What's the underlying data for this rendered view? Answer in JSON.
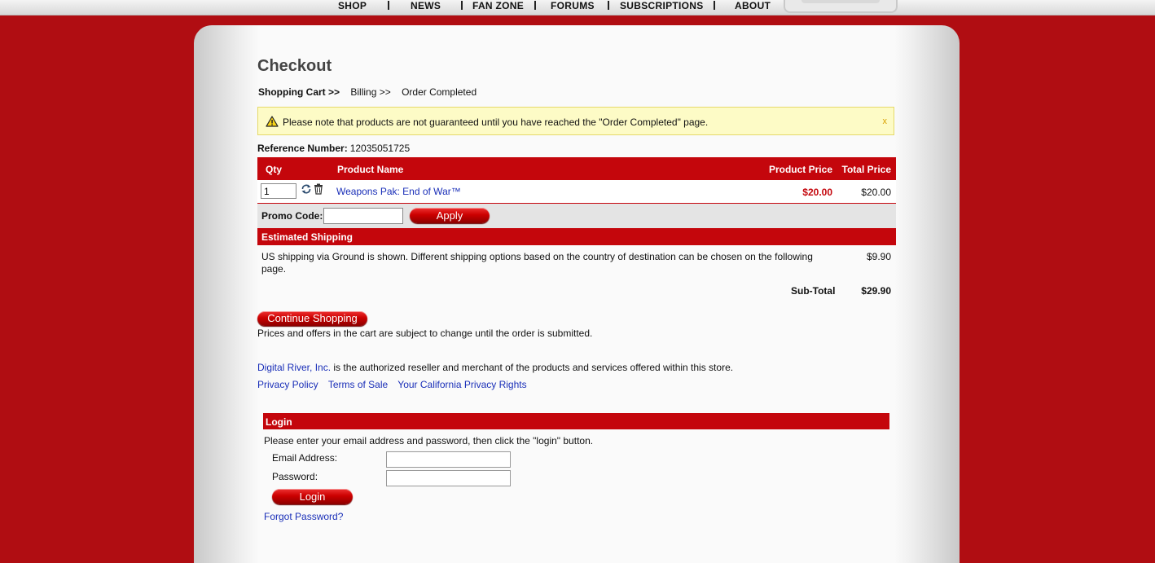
{
  "nav": {
    "items": [
      "SHOP",
      "NEWS",
      "FAN ZONE",
      "FORUMS",
      "SUBSCRIPTIONS",
      "ABOUT"
    ]
  },
  "checkout": {
    "title": "Checkout",
    "breadcrumbs": [
      "Shopping Cart >>",
      "Billing >>",
      "Order Completed"
    ],
    "notice": "Please note that products are not guaranteed until you have reached the \"Order Completed\" page.",
    "notice_close": "x",
    "reference_label": "Reference Number:",
    "reference_number": "12035051725"
  },
  "cart": {
    "columns": [
      "Qty",
      "Product Name",
      "Product Price",
      "Total Price"
    ],
    "items": [
      {
        "qty": "1",
        "name": "Weapons Pak: End of War™",
        "price": "$20.00",
        "total": "$20.00"
      }
    ],
    "promo_label": "Promo Code:",
    "promo_value": "",
    "apply_label": "Apply"
  },
  "shipping": {
    "heading": "Estimated Shipping",
    "text": "US shipping via Ground is shown. Different shipping options based on the country of destination can be chosen on the following page.",
    "price": "$9.90",
    "subtotal_label": "Sub-Total",
    "subtotal_value": "$29.90"
  },
  "continue_label": "Continue Shopping",
  "prices_note": "Prices and offers in the cart are subject to change until the order is submitted.",
  "reseller": {
    "link": "Digital River, Inc.",
    "text": " is the authorized reseller and merchant of the products and services offered within this store."
  },
  "legal_links": [
    "Privacy Policy",
    "Terms of Sale",
    "Your California Privacy Rights"
  ],
  "login": {
    "heading": "Login",
    "instructions": "Please enter your email address and password, then click the \"login\" button.",
    "email_label": "Email Address:",
    "email_value": "",
    "password_label": "Password:",
    "password_value": "",
    "button": "Login",
    "forgot": "Forgot Password?"
  },
  "colors": {
    "brand_red": "#c4060c",
    "background_red": "#b00d12",
    "link_blue": "#1a2fb8",
    "notice_bg": "#fdfbc6"
  },
  "icons": [
    "warning-icon",
    "refresh-icon",
    "trash-icon"
  ]
}
